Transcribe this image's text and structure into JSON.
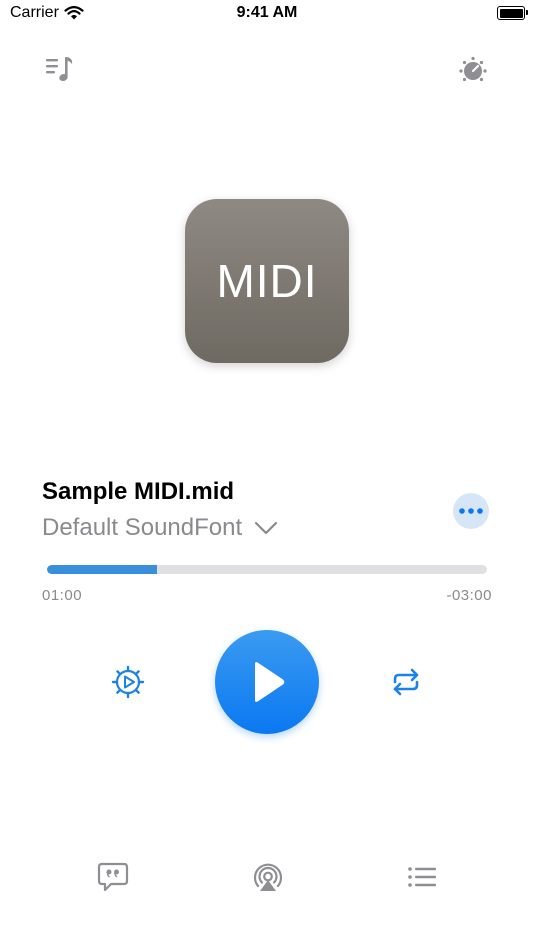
{
  "status_bar": {
    "carrier": "Carrier",
    "time": "9:41 AM"
  },
  "top_bar": {
    "left_icon": "playlist-music-icon",
    "right_icon": "knob-settings-icon"
  },
  "artwork": {
    "label": "MIDI"
  },
  "track": {
    "title": "Sample MIDI.mid",
    "soundfont": "Default SoundFont"
  },
  "progress": {
    "elapsed": "01:00",
    "remaining": "-03:00",
    "fraction": 0.25
  },
  "controls": {
    "left_icon": "gear-play-icon",
    "center_icon": "play-icon",
    "right_icon": "repeat-icon"
  },
  "bottom_bar": {
    "left_icon": "lyrics-icon",
    "center_icon": "airplay-icon",
    "right_icon": "list-icon"
  },
  "colors": {
    "accent": "#0A78F2",
    "icon_gray": "#8E8E93",
    "artwork_top": "#8F8983",
    "artwork_bottom": "#6E6961"
  }
}
